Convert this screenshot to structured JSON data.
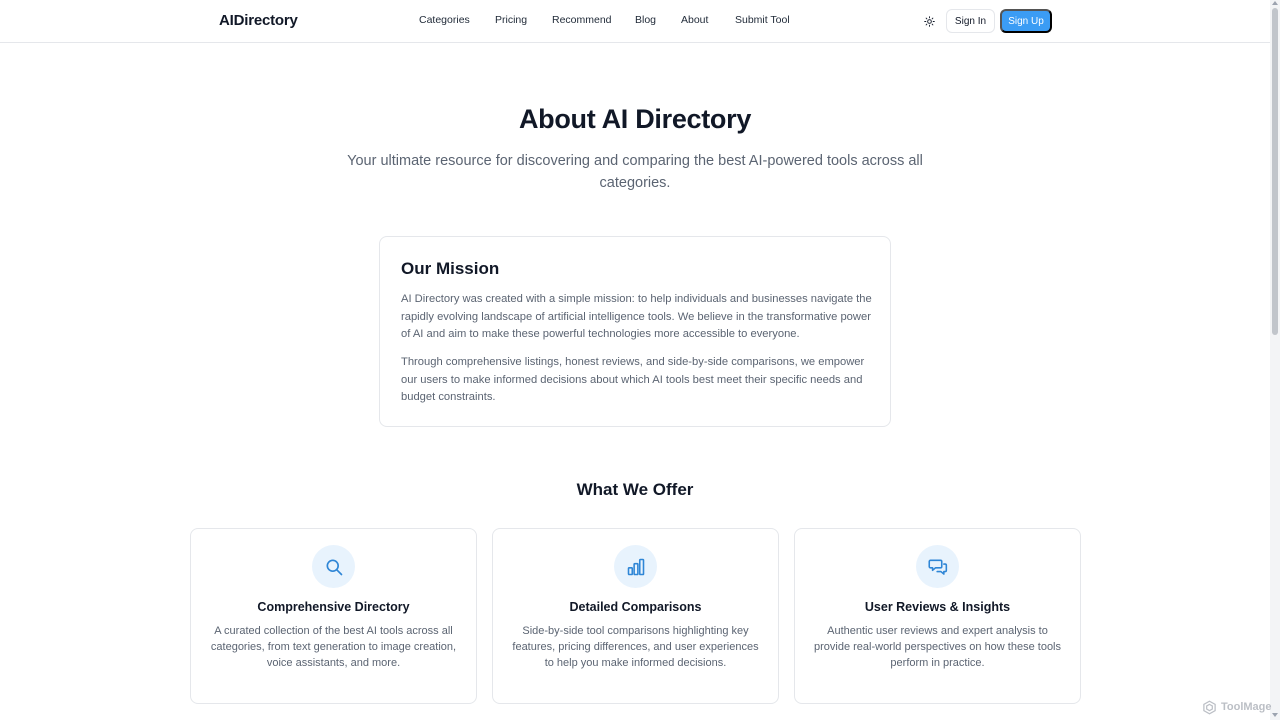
{
  "header": {
    "logo": "AIDirectory",
    "nav": [
      {
        "label": "Categories"
      },
      {
        "label": "Pricing"
      },
      {
        "label": "Recommend"
      },
      {
        "label": "Blog"
      },
      {
        "label": "About"
      },
      {
        "label": "Submit Tool"
      }
    ],
    "theme_icon": "sun-icon",
    "sign_in_label": "Sign In",
    "sign_up_label": "Sign Up"
  },
  "hero": {
    "title": "About AI Directory",
    "subtitle": "Your ultimate resource for discovering and comparing the best AI-powered tools across all categories."
  },
  "mission": {
    "title": "Our Mission",
    "paragraphs": [
      "AI Directory was created with a simple mission: to help individuals and businesses navigate the rapidly evolving landscape of artificial intelligence tools. We believe in the transformative power of AI and aim to make these powerful technologies more accessible to everyone.",
      "Through comprehensive listings, honest reviews, and side-by-side comparisons, we empower our users to make informed decisions about which AI tools best meet their specific needs and budget constraints."
    ]
  },
  "offer": {
    "title": "What We Offer",
    "cards": [
      {
        "icon": "search-icon",
        "title": "Comprehensive Directory",
        "description": "A curated collection of the best AI tools across all categories, from text generation to image creation, voice assistants, and more."
      },
      {
        "icon": "bar-chart-icon",
        "title": "Detailed Comparisons",
        "description": "Side-by-side tool comparisons highlighting key features, pricing differences, and user experiences to help you make informed decisions."
      },
      {
        "icon": "chat-bubbles-icon",
        "title": "User Reviews & Insights",
        "description": "Authentic user reviews and expert analysis to provide real-world perspectives on how these tools perform in practice."
      }
    ]
  },
  "watermark": {
    "text": "ToolMage"
  },
  "colors": {
    "accent": "#3b9cf4",
    "icon_bg": "#e8f3fd",
    "icon_stroke": "#2f86d6",
    "text_primary": "#111827",
    "text_muted": "#5b6472",
    "border": "#e5e7eb"
  }
}
